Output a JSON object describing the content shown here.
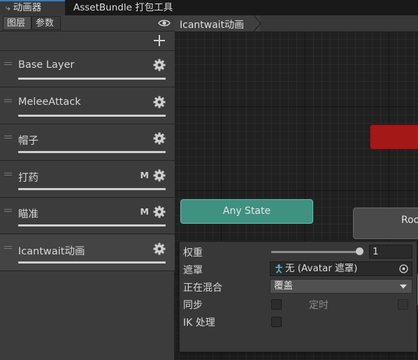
{
  "window_tabs": {
    "animator": {
      "icon": "animator-graph-icon",
      "label": "动画器"
    },
    "assetbundle": {
      "label": "AssetBundle 打包工具"
    }
  },
  "left_panel": {
    "tabs": {
      "layers": "图层",
      "parameters": "参数"
    },
    "visibility_icon": "eye-icon",
    "add_icon": "plus-icon",
    "layers": [
      {
        "name": "Base Layer",
        "badge": "",
        "weight": 1.0,
        "selected": false
      },
      {
        "name": "MeleeAttack",
        "badge": "",
        "weight": 1.0,
        "selected": false
      },
      {
        "name": "帽子",
        "badge": "",
        "weight": 1.0,
        "selected": false
      },
      {
        "name": "打药",
        "badge": "M",
        "weight": 1.0,
        "selected": false
      },
      {
        "name": "瞄准",
        "badge": "M",
        "weight": 1.0,
        "selected": false
      },
      {
        "name": "Icantwait动画",
        "badge": "",
        "weight": 1.0,
        "selected": true
      }
    ]
  },
  "graph": {
    "breadcrumb": "Icantwait动画",
    "nodes": {
      "any_state": "Any State",
      "partial_node": "Roo"
    },
    "colors": {
      "any_state": "#3f9180",
      "red_node": "#a51818",
      "orange_node": "#c78a25"
    }
  },
  "layer_settings": {
    "weight": {
      "label": "权重",
      "value": "1",
      "slider_fraction": 1.0
    },
    "mask": {
      "label": "遮罩",
      "value": "无 (Avatar 遮罩)",
      "icon": "avatar-mask-icon"
    },
    "blending": {
      "label": "正在混合",
      "value": "覆盖"
    },
    "sync": {
      "label": "同步",
      "checked": false
    },
    "timing": {
      "label": "定时",
      "checked": false,
      "enabled": false
    },
    "ik_pass": {
      "label": "IK 处理",
      "checked": false
    }
  }
}
